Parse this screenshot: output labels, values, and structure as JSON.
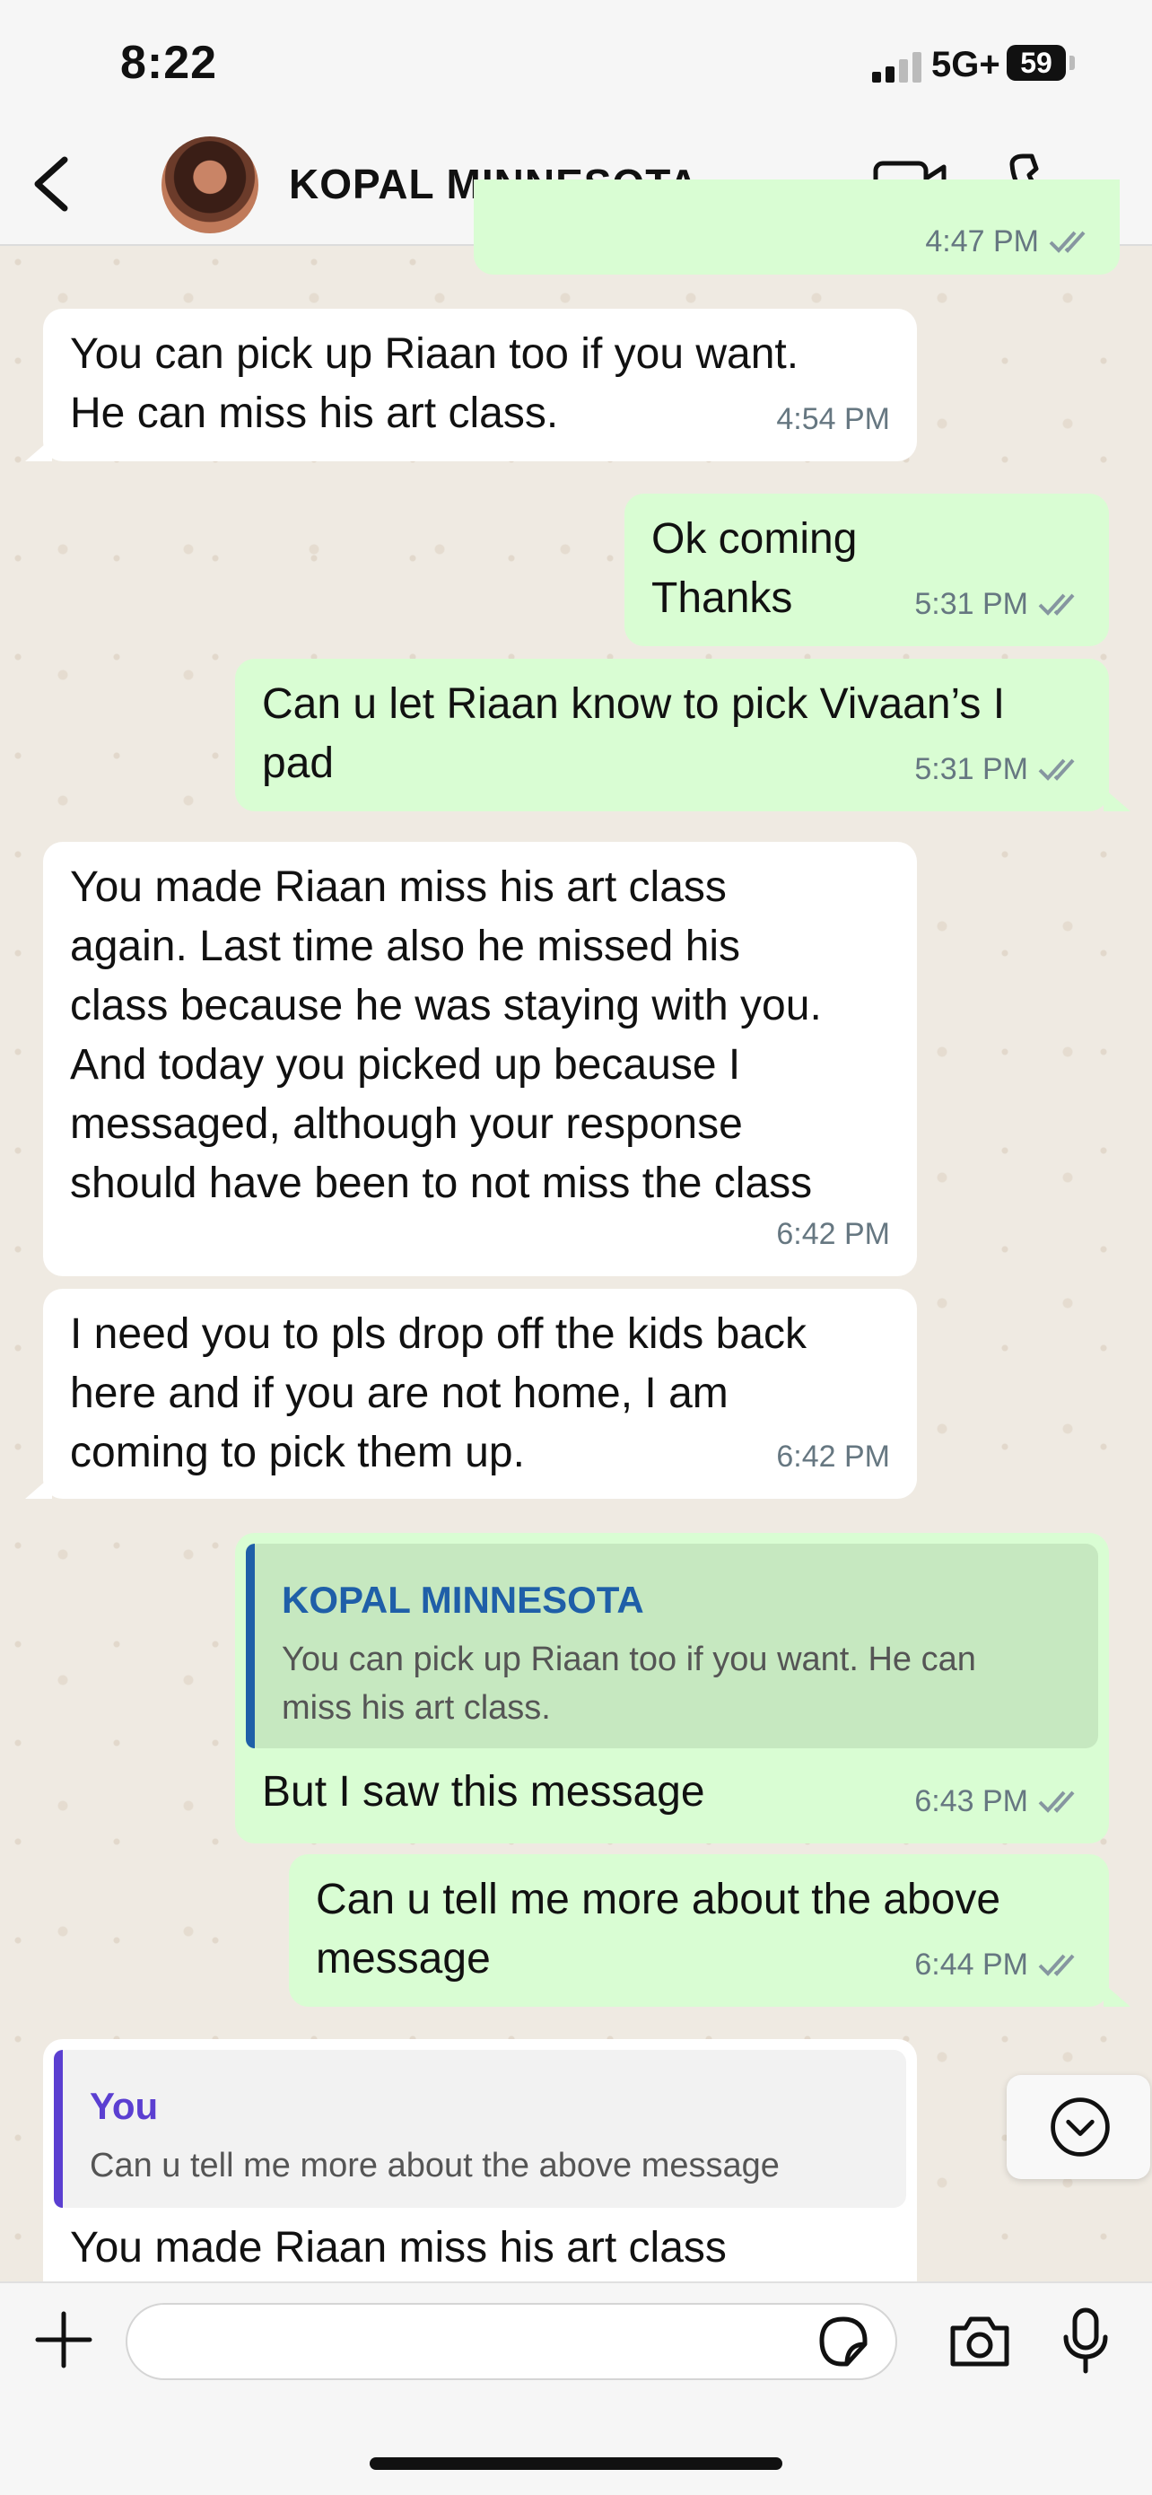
{
  "status_bar": {
    "time": "8:22",
    "network": "5G+",
    "battery": "59"
  },
  "header": {
    "contact_name": "KOPAL MINNESOTA"
  },
  "messages": [
    {
      "direction": "out",
      "text": "",
      "time": "4:47 PM"
    },
    {
      "direction": "in",
      "text": "You can pick up Riaan too if you want.\nHe can miss his art class.",
      "time": "4:54 PM"
    },
    {
      "direction": "out",
      "text": "Ok coming\nThanks",
      "time": "5:31 PM"
    },
    {
      "direction": "out",
      "text": "Can u let Riaan know to pick Vivaan’s I\npad",
      "time": "5:31 PM"
    },
    {
      "direction": "in",
      "text": "You made Riaan miss his art class\nagain. Last time also he missed his\nclass because he was staying with you.\nAnd today you picked up because I\nmessaged, although your response\nshould have been to not miss the class",
      "time": "6:42 PM"
    },
    {
      "direction": "in",
      "text": "I need you to pls drop off the kids back\nhere and if you are not home, I am\ncoming to pick them up.",
      "time": "6:42 PM"
    },
    {
      "direction": "out",
      "quote": {
        "name": "KOPAL MINNESOTA",
        "text": "You can pick up Riaan too if you want. He can\nmiss his art class."
      },
      "text": "But I saw this message",
      "time": "6:43 PM"
    },
    {
      "direction": "out",
      "text": "Can u tell me more about the above\nmessage",
      "time": "6:44 PM"
    },
    {
      "direction": "in",
      "quote": {
        "name": "You",
        "text": "Can u tell me more about the above message"
      },
      "text": "You made Riaan miss his art class",
      "time": ""
    }
  ],
  "input": {
    "placeholder": ""
  },
  "colors": {
    "outgoing": "#d9fdd3",
    "incoming": "#ffffff",
    "wallpaper": "#efeae2",
    "ticks": "#8696a0",
    "quote_bar_contact": "#1f5fa8",
    "quote_bar_you": "#5b3fd1"
  },
  "icons": [
    "back-chevron-icon",
    "video-call-icon",
    "phone-icon",
    "scroll-down-icon",
    "plus-icon",
    "sticker-icon",
    "camera-icon",
    "microphone-icon",
    "double-check-icon"
  ]
}
